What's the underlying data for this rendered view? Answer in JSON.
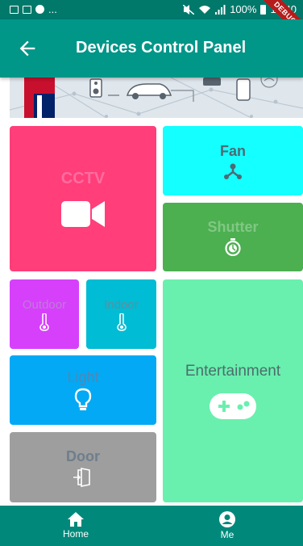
{
  "status_bar": {
    "notification_ellipsis": "...",
    "battery": "100%",
    "time": "19:40",
    "debug_label": "DEBUG"
  },
  "app_bar": {
    "title": "Devices Control Panel",
    "back_icon": "arrow-back-icon"
  },
  "tiles": {
    "cctv": {
      "label": "CCTV",
      "icon": "videocam-icon",
      "bg": "#ff3e7a",
      "fg": "#ff6da0"
    },
    "fan": {
      "label": "Fan",
      "icon": "device-hub-icon",
      "bg": "#14ffff",
      "fg": "#4e6a73"
    },
    "shutter": {
      "label": "Shutter",
      "icon": "timer-icon",
      "bg": "#4caf50",
      "fg": "#80c883"
    },
    "outdoor": {
      "label": "Outdoor",
      "icon": "thermometer-icon",
      "bg": "#d640fb",
      "fg": "#bf7ad8"
    },
    "indoor": {
      "label": "Indoor",
      "icon": "thermometer-icon",
      "bg": "#00bcd4",
      "fg": "#5c8fa0"
    },
    "light": {
      "label": "Light",
      "icon": "lightbulb-icon",
      "bg": "#03a9f4",
      "fg": "#4f88b5"
    },
    "entertainment": {
      "label": "Entertainment",
      "icon": "gamepad-icon",
      "bg": "#69f0ae",
      "fg": "#4c6e6d"
    },
    "door": {
      "label": "Door",
      "icon": "door-enter-icon",
      "bg": "#9e9e9e",
      "fg": "#6e7e8c"
    }
  },
  "bottom_nav": {
    "items": [
      {
        "label": "Home",
        "icon": "home-icon"
      },
      {
        "label": "Me",
        "icon": "account-circle-icon"
      }
    ]
  },
  "colors": {
    "status_bar": "#00796b",
    "app_bar": "#009688",
    "bottom_nav": "#00897b"
  }
}
